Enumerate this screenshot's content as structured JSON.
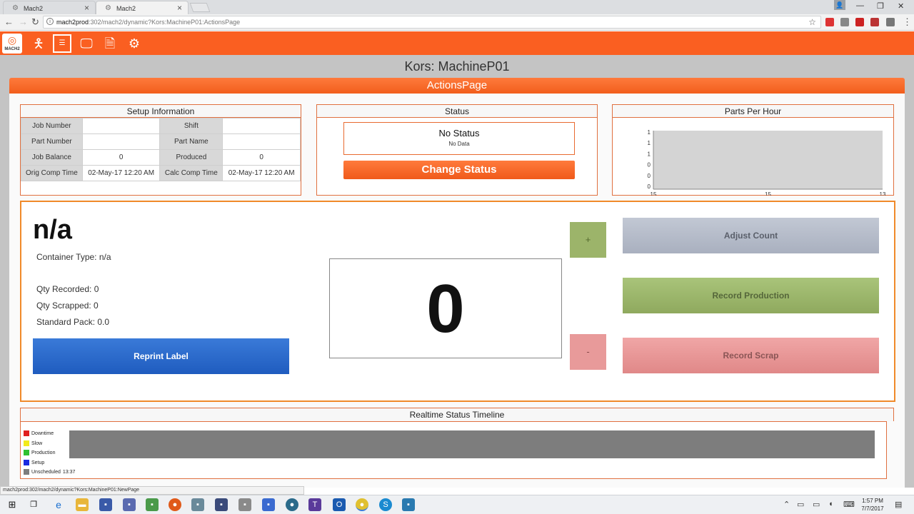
{
  "browser": {
    "tabs": [
      {
        "title": "Mach2",
        "active": false
      },
      {
        "title": "Mach2",
        "active": true
      }
    ],
    "url_host": "mach2prod",
    "url_path": ":302/mach2/dynamic?Kors:MachineP01:ActionsPage",
    "status_url": "mach2prod:302/mach2/dynamic?Kors:MachineP01:NewPage"
  },
  "app": {
    "logo_text": "MACH2",
    "machine_title": "Kors: MachineP01",
    "page_header": "ActionsPage"
  },
  "setup": {
    "title": "Setup Information",
    "rows": [
      [
        {
          "label": "Job Number",
          "value": ""
        },
        {
          "label": "Shift",
          "value": ""
        }
      ],
      [
        {
          "label": "Part Number",
          "value": ""
        },
        {
          "label": "Part Name",
          "value": ""
        }
      ],
      [
        {
          "label": "Job Balance",
          "value": "0"
        },
        {
          "label": "Produced",
          "value": "0"
        }
      ],
      [
        {
          "label": "Orig Comp Time",
          "value": "02-May-17 12:20 AM"
        },
        {
          "label": "Calc Comp Time",
          "value": "02-May-17 12:20 AM"
        }
      ]
    ]
  },
  "status": {
    "title": "Status",
    "main": "No Status",
    "sub": "No Data",
    "change_button": "Change Status"
  },
  "pph": {
    "title": "Parts Per Hour"
  },
  "chart_data": {
    "type": "area",
    "title": "Parts Per Hour",
    "x_tick_labels": [
      "15",
      "15",
      "13"
    ],
    "y_tick_labels": [
      "1",
      "1",
      "1",
      "0",
      "0",
      "0"
    ],
    "series": [],
    "grid": false
  },
  "action": {
    "container_name": "n/a",
    "container_type": "Container Type: n/a",
    "qty_recorded": "Qty Recorded: 0",
    "qty_scrapped": "Qty Scrapped: 0",
    "standard_pack": "Standard Pack: 0.0",
    "reprint_label": "Reprint Label",
    "count": "0",
    "plus": "+",
    "minus": "-",
    "adjust_count": "Adjust Count",
    "record_production": "Record Production",
    "record_scrap": "Record Scrap"
  },
  "timeline": {
    "title": "Realtime Status Timeline",
    "legend": [
      {
        "label": "Downtime",
        "color": "#e02020"
      },
      {
        "label": "Slow",
        "color": "#f2ea1a"
      },
      {
        "label": "Production",
        "color": "#30c030"
      },
      {
        "label": "Setup",
        "color": "#1a2ae0"
      },
      {
        "label": "Unscheduled",
        "color": "#7d7d7d"
      }
    ],
    "time_label": "13:37"
  },
  "taskbar": {
    "time": "1:57 PM",
    "date": "7/7/2017"
  }
}
